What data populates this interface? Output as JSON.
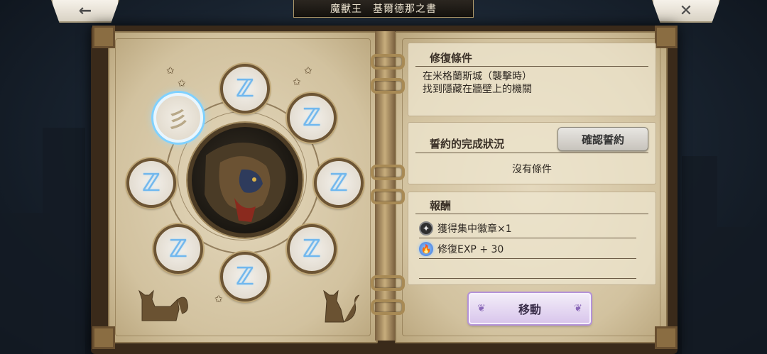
{
  "header": {
    "back_icon": "←",
    "close_icon": "✕",
    "title": "魔獸王　基爾德那之書"
  },
  "left_page": {
    "nodes": [
      {
        "id": "node-1",
        "glyph": "彡",
        "state": "active"
      },
      {
        "id": "node-2",
        "glyph": "ℤ",
        "state": "locked"
      },
      {
        "id": "node-3",
        "glyph": "ℤ",
        "state": "locked"
      },
      {
        "id": "node-4",
        "glyph": "ℤ",
        "state": "locked"
      },
      {
        "id": "node-5",
        "glyph": "ℤ",
        "state": "locked"
      },
      {
        "id": "node-6",
        "glyph": "ℤ",
        "state": "locked"
      },
      {
        "id": "node-7",
        "glyph": "ℤ",
        "state": "locked"
      },
      {
        "id": "node-8",
        "glyph": "ℤ",
        "state": "locked"
      }
    ]
  },
  "repair_conditions": {
    "title": "修復條件",
    "line1": "在米格蘭斯城（襲擊時）",
    "line2": "找到隱藏在牆壁上的機關"
  },
  "oath_status": {
    "title": "誓約的完成狀況",
    "confirm_label": "確認誓約",
    "status_text": "沒有條件"
  },
  "rewards": {
    "title": "報酬",
    "items": [
      {
        "icon": "medal-icon",
        "label": "獲得集中徽章×1"
      },
      {
        "icon": "exp-flame-icon",
        "label": "修復EXP + 30"
      }
    ]
  },
  "actions": {
    "move_label": "移動"
  }
}
